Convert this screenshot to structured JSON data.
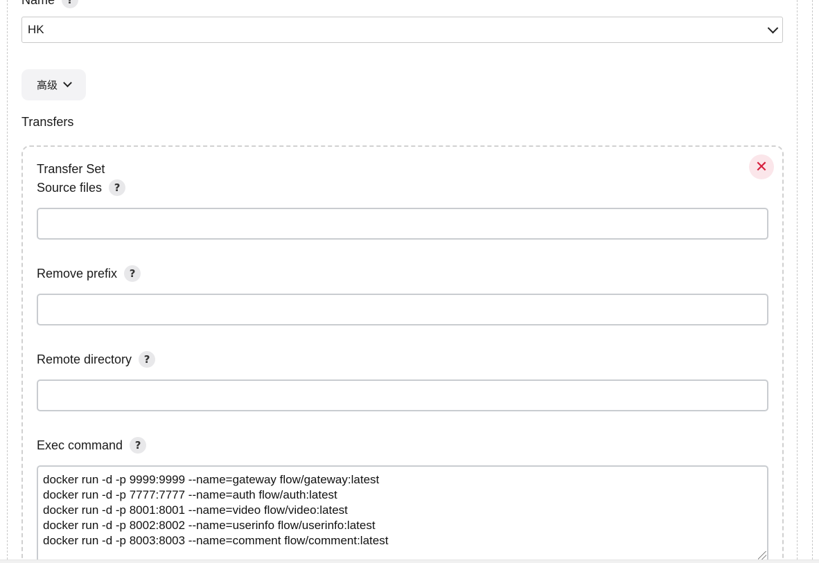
{
  "name_field": {
    "label": "Name",
    "help": "?",
    "selected_value": "HK"
  },
  "advanced_button": {
    "label": "高级"
  },
  "transfers": {
    "title": "Transfers",
    "transfer_set": {
      "title": "Transfer Set",
      "close_symbol": "✕",
      "source_files": {
        "label": "Source files",
        "help": "?",
        "value": ""
      },
      "remove_prefix": {
        "label": "Remove prefix",
        "help": "?",
        "value": ""
      },
      "remote_directory": {
        "label": "Remote directory",
        "help": "?",
        "value": ""
      },
      "exec_command": {
        "label": "Exec command",
        "help": "?",
        "lines": [
          "docker run -d -p 9999:9999 --name=gateway flow/gateway:latest",
          "docker run -d -p 7777:7777 --name=auth flow/auth:latest",
          "docker run -d -p 8001:8001 --name=video flow/video:latest",
          "docker run -d -p 8002:8002 --name=userinfo flow/userinfo:latest",
          "docker run -d -p 8003:8003 --name=comment flow/comment:latest"
        ]
      }
    }
  },
  "colors": {
    "close_red": "#d6203e",
    "close_bg": "#fbe6ea",
    "help_bg": "#e8e8ea"
  },
  "icons": {
    "dropdown": "chevron-down-icon",
    "close": "close-icon",
    "help": "help-icon"
  }
}
